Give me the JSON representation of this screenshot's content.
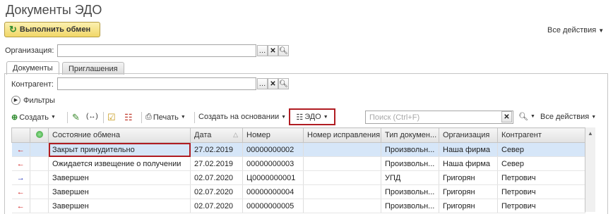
{
  "title": "Документы ЭДО",
  "exchange_button": "Выполнить обмен",
  "all_actions_top": "Все действия",
  "organization": {
    "label": "Организация:",
    "value": ""
  },
  "tabs": [
    {
      "label": "Документы"
    },
    {
      "label": "Приглашения"
    }
  ],
  "counterparty": {
    "label": "Контрагент:",
    "value": ""
  },
  "filters_label": "Фильтры",
  "toolbar": {
    "create": "Создать",
    "edit_icon_text": "",
    "print": "Печать",
    "create_based": "Создать на основании",
    "edo": "ЭДО",
    "search_placeholder": "Поиск (Ctrl+F)",
    "all_actions": "Все действия"
  },
  "columns": [
    "",
    "",
    "Состояние обмена",
    "Дата",
    "Номер",
    "Номер исправления",
    "Тип докумен...",
    "Организация",
    "Контрагент"
  ],
  "rows": [
    {
      "dir": "in",
      "state": "Закрыт принудительно",
      "date": "27.02.2019",
      "number": "00000000002",
      "corr": "",
      "type": "Произвольн...",
      "org": "Наша фирма",
      "contr": "Север"
    },
    {
      "dir": "in",
      "state": "Ожидается извещение о получении",
      "date": "27.02.2019",
      "number": "00000000003",
      "corr": "",
      "type": "Произвольн...",
      "org": "Наша фирма",
      "contr": "Север"
    },
    {
      "dir": "out",
      "state": "Завершен",
      "date": "02.07.2020",
      "number": "Ц0000000001",
      "corr": "",
      "type": "УПД",
      "org": "Григорян",
      "contr": "Петрович"
    },
    {
      "dir": "in",
      "state": "Завершен",
      "date": "02.07.2020",
      "number": "00000000004",
      "corr": "",
      "type": "Произвольн...",
      "org": "Григорян",
      "contr": "Петрович"
    },
    {
      "dir": "in",
      "state": "Завершен",
      "date": "02.07.2020",
      "number": "00000000005",
      "corr": "",
      "type": "Произвольн...",
      "org": "Григорян",
      "contr": "Петрович"
    }
  ],
  "colors": {
    "accent_red": "#b01c22",
    "selection": "#d6e6f8",
    "arrow_in": "#d01515",
    "arrow_out": "#1d2fb8",
    "title": "#4a4a4a"
  }
}
